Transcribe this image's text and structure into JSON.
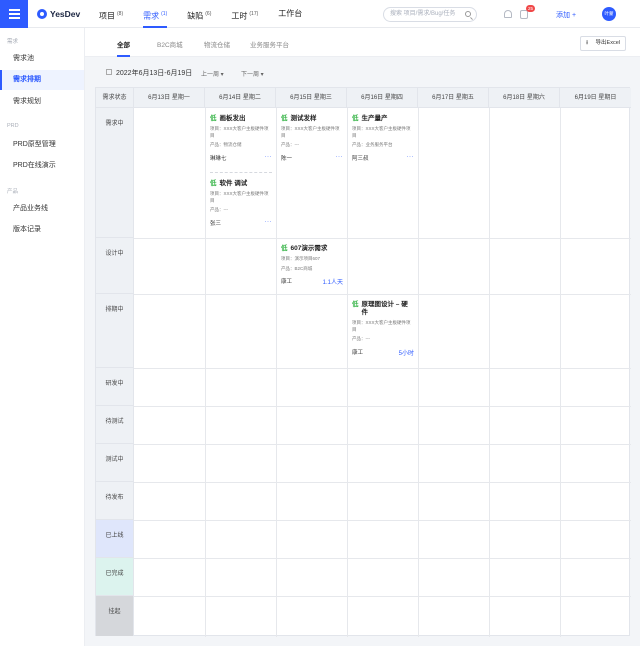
{
  "app": {
    "logo_text": "YesDev"
  },
  "nav": [
    {
      "label": "项目",
      "count": "(8)"
    },
    {
      "label": "需求",
      "count": "(1)"
    },
    {
      "label": "缺陷",
      "count": "(6)"
    },
    {
      "label": "工时",
      "count": "(17)"
    },
    {
      "label": "工作台",
      "count": ""
    }
  ],
  "search": {
    "placeholder": "搜索 项目/需求/Bug/任务"
  },
  "header": {
    "tasks_badge": "25",
    "add_label": "添加 +",
    "avatar_text": "叶蒙"
  },
  "sidebar": {
    "groups": [
      "需求",
      "PRD",
      "产品"
    ],
    "items": [
      "需求池",
      "需求排期",
      "需求规划",
      "PRD原型管理",
      "PRD在线演示",
      "产品业务线",
      "版本记录"
    ]
  },
  "sub_tabs": [
    "全部",
    "B2C商城",
    "物流仓储",
    "业务服务平台"
  ],
  "export_label": "导出Excel",
  "toolbar": {
    "date_range": "2022年6月13日-6月19日",
    "prev_week": "上一周 ▾",
    "next_week": "下一周 ▾"
  },
  "board": {
    "status_header": "需求状态",
    "days": [
      "6月13日 星期一",
      "6月14日 星期二",
      "6月15日 星期三",
      "6月16日 星期四",
      "6月17日 星期五",
      "6月18日 星期六",
      "6月19日 星期日"
    ],
    "statuses": [
      "需求中",
      "设计中",
      "排期中",
      "研发中",
      "待测试",
      "测试中",
      "待发布",
      "已上线",
      "已完成",
      "挂起"
    ]
  },
  "cards": [
    {
      "priority": "低",
      "title": "画板发出",
      "project": "项目：XXX大客户主板硬件项目",
      "product": "产品：物流仓储",
      "owner": "琳琳七",
      "more": "···"
    },
    {
      "priority": "低",
      "title": "软件 调试",
      "project": "项目：XXX大客户主板硬件项目",
      "product": "产品：---",
      "owner": "张三",
      "more": "···"
    },
    {
      "priority": "低",
      "title": "测试发样",
      "project": "项目：XXX大客户主板硬件项目",
      "product": "产品：---",
      "owner": "陈一",
      "more": "···"
    },
    {
      "priority": "低",
      "title": "生产量产",
      "project": "项目：XXX大客户主板硬件项目",
      "product": "产品：业务服务平台",
      "owner": "阿三叔",
      "more": "···"
    },
    {
      "priority": "低",
      "title": "607演示需求",
      "project": "项目：演示项目607",
      "product": "产品：B2C商城",
      "owner": "康工",
      "duration": "1.1人天"
    },
    {
      "priority": "低",
      "title": "原理图设计 – 硬件",
      "project": "项目：XXX大客户主板硬件项目",
      "product": "产品：---",
      "owner": "康工",
      "duration": "5小时"
    }
  ],
  "colors": {
    "accent": "#2e5bff",
    "priority_low": "#39b54a",
    "badge": "#f04848"
  }
}
